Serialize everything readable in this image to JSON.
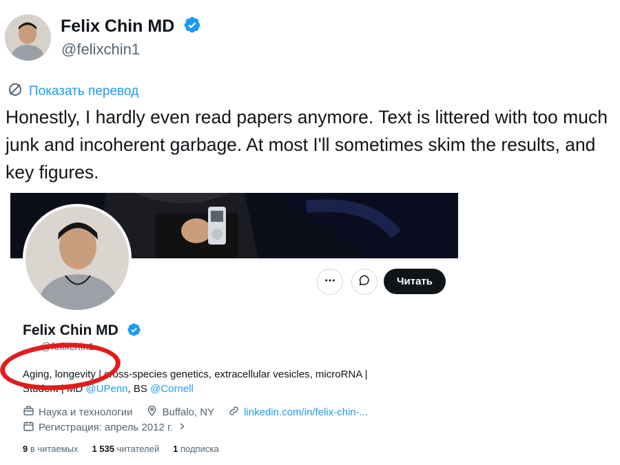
{
  "tweet": {
    "author_name": "Felix Chin MD",
    "author_handle": "@felixchin1",
    "translate_link": "Показать перевод",
    "text": "Honestly, I hardly even read papers anymore. Text is littered with too much junk and incoherent garbage. At most I'll sometimes skim the results, and key figures."
  },
  "profile": {
    "name": "Felix Chin MD",
    "handle": "@felixchin1",
    "follow_label": "Читать",
    "bio_line1_prefix": "Aging, longevity | cross-species genetics, extracellular vesicles, microRNA |",
    "bio_line2_prefix": "Student | MD ",
    "bio_link_upenn": "@UPenn",
    "bio_middle": ", BS ",
    "bio_link_cornell": "@Cornell",
    "category": "Наука и технологии",
    "location": "Buffalo, NY",
    "website": "linkedin.com/in/felix-chin-...",
    "joined": "Регистрация: апрель 2012 г.",
    "following_count": "9",
    "following_label": "в читаемых",
    "followers_count": "1 535",
    "followers_label": "читателей",
    "subscriptions_count": "1",
    "subscriptions_label": "подписка"
  },
  "colors": {
    "accent": "#1d9bf0",
    "annotation_red": "#e01c1c",
    "text_primary": "#0f1419",
    "text_secondary": "#536471"
  },
  "icons": [
    "verified-badge-icon",
    "translate-icon",
    "more-icon",
    "message-icon",
    "briefcase-icon",
    "location-pin-icon",
    "link-icon",
    "calendar-icon",
    "chevron-right-icon"
  ]
}
